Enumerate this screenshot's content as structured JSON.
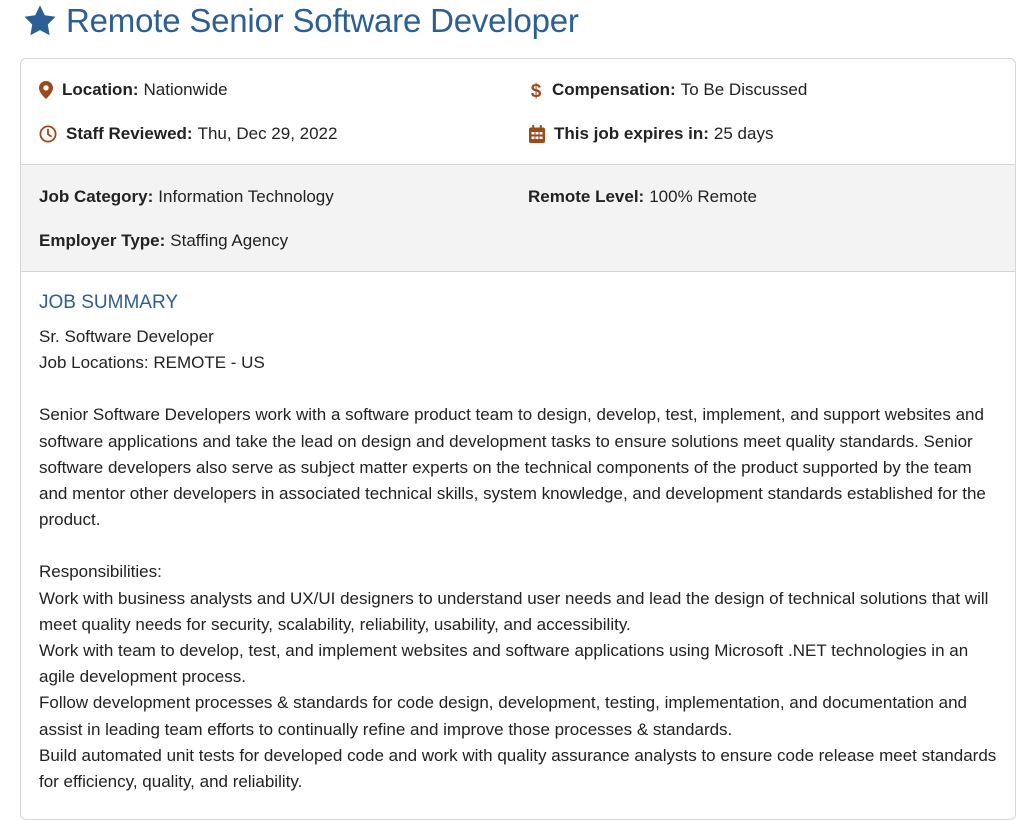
{
  "job": {
    "title": "Remote Senior Software Developer"
  },
  "details": {
    "location_label": "Location:",
    "location_value": "Nationwide",
    "compensation_label": "Compensation:",
    "compensation_value": "To Be Discussed",
    "reviewed_label": "Staff Reviewed:",
    "reviewed_value": "Thu, Dec 29, 2022",
    "expires_label": "This job expires in:",
    "expires_value": "25 days"
  },
  "categories": {
    "category_label": "Job Category:",
    "category_value": "Information Technology",
    "remote_label": "Remote Level:",
    "remote_value": "100% Remote",
    "employer_label": "Employer Type:",
    "employer_value": "Staffing Agency"
  },
  "summary": {
    "heading": "JOB SUMMARY",
    "line1": "Sr. Software Developer",
    "line2": "Job Locations: REMOTE - US",
    "para1": "Senior Software Developers work with a software product team to design, develop, test, implement, and support websites and software applications and take the lead on design and development tasks to ensure solutions meet quality standards. Senior software developers also serve as subject matter experts on the technical components of the product supported by the team and mentor other developers in associated technical skills, system knowledge, and development standards established for the product.",
    "resp_heading": "Responsibilities:",
    "resp1": "Work with business analysts and UX/UI designers to understand user needs and lead the design of technical solutions that will meet quality needs for security, scalability, reliability, usability, and accessibility.",
    "resp2": "Work with team to develop, test, and implement websites and software applications using Microsoft .NET technologies in an agile development process.",
    "resp3": "Follow development processes & standards for code design, development, testing, implementation, and documentation and assist in leading team efforts to continually refine and improve those processes & standards.",
    "resp4": "Build automated unit tests for developed code and work with quality assurance analysts to ensure code release meet standards for efficiency, quality, and reliability."
  },
  "colors": {
    "title": "#2d5f95",
    "icon": "#9c4a1c",
    "text": "#222222"
  },
  "icons": [
    "star-icon",
    "map-pin-icon",
    "dollar-icon",
    "clock-icon",
    "calendar-icon"
  ]
}
